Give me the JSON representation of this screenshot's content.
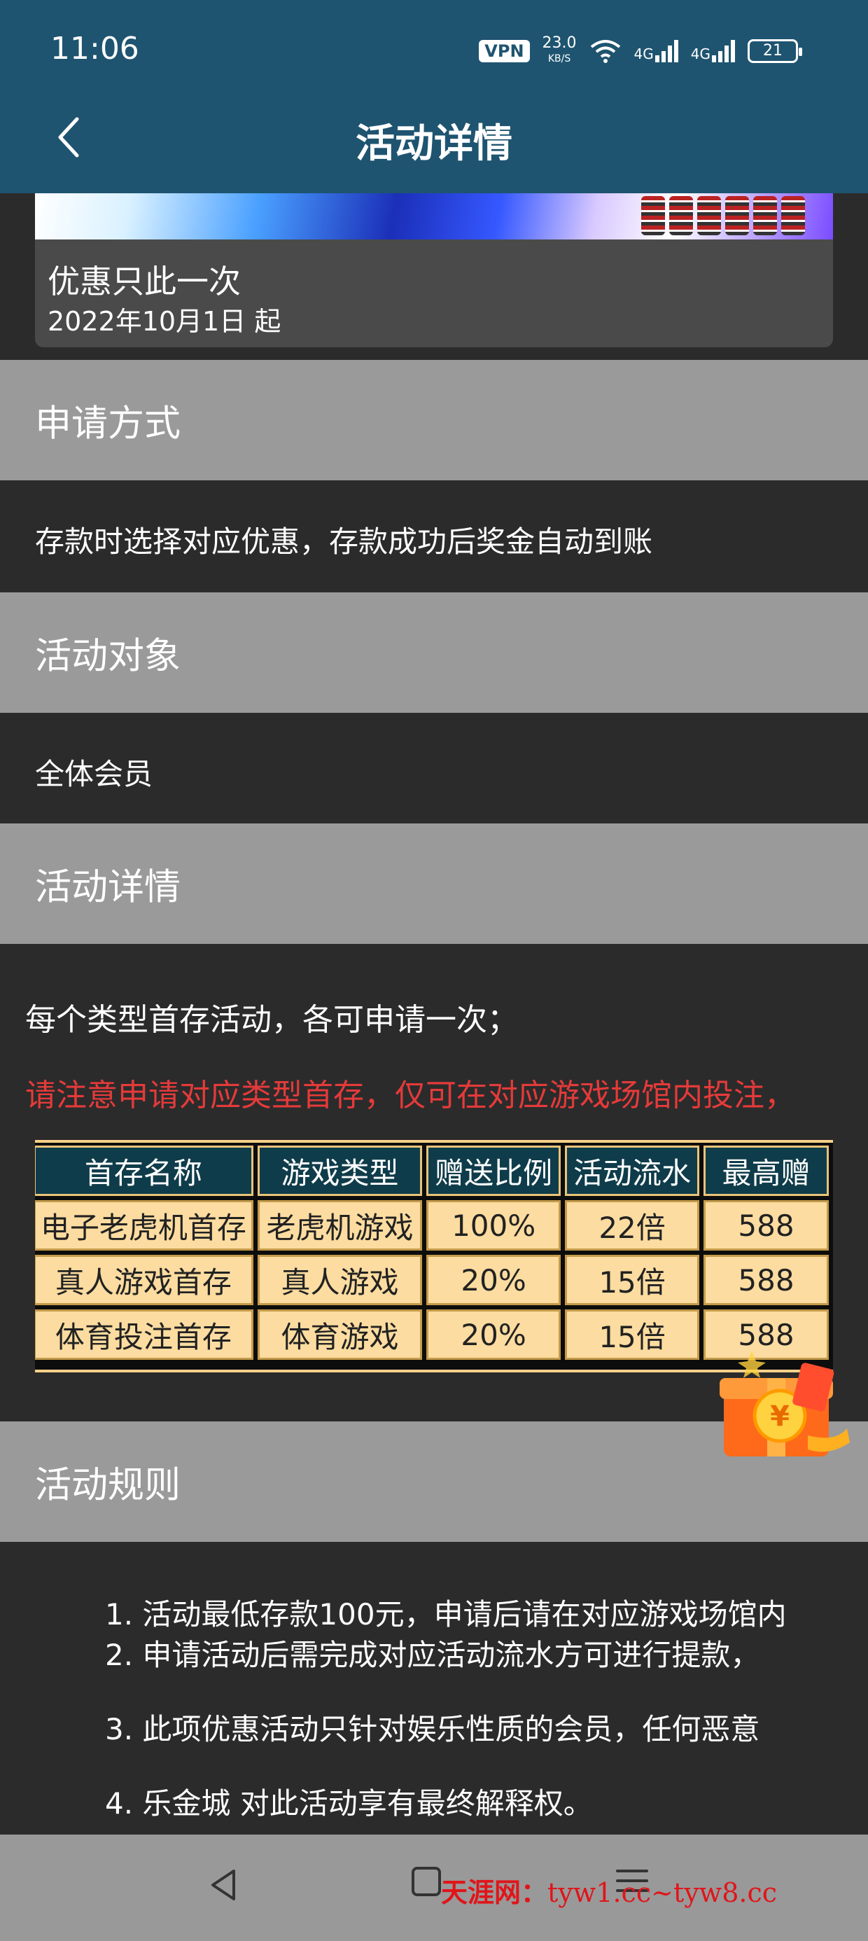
{
  "status_bar": {
    "time": "11:06",
    "vpn": "VPN",
    "net_speed": "23.0",
    "net_unit": "KB/S",
    "signal1": "4G",
    "signal2": "4G",
    "battery": "21"
  },
  "header": {
    "title": "活动详情",
    "back_icon": "chevron-left-icon"
  },
  "promo_card": {
    "title": "优惠只此一次",
    "date": "2022年10月1日 起"
  },
  "sections": {
    "apply": {
      "heading": "申请方式",
      "body": "存款时选择对应优惠，存款成功后奖金自动到账"
    },
    "target": {
      "heading": "活动对象",
      "body": "全体会员"
    },
    "details": {
      "heading": "活动详情",
      "line1": "每个类型首存活动，各可申请一次；",
      "line2": "请注意申请对应类型首存，仅可在对应游戏场馆内投注，"
    },
    "rules": {
      "heading": "活动规则",
      "items": [
        "1. 活动最低存款100元，申请后请在对应游戏场馆内",
        "2. 申请活动后需完成对应活动流水方可进行提款，",
        "3. 此项优惠活动只针对娱乐性质的会员，任何恶意",
        "4. 乐金城 对此活动享有最终解释权。"
      ]
    }
  },
  "table": {
    "headers": [
      "首存名称",
      "游戏类型",
      "赠送比例",
      "活动流水",
      "最高赠"
    ],
    "rows": [
      [
        "电子老虎机首存",
        "老虎机游戏",
        "100%",
        "22倍",
        "588"
      ],
      [
        "真人游戏首存",
        "真人游戏",
        "20%",
        "15倍",
        "588"
      ],
      [
        "体育投注首存",
        "体育游戏",
        "20%",
        "15倍",
        "588"
      ]
    ]
  },
  "colors": {
    "header_bg": "#1e5470",
    "section_head_bg": "#9a9a9a",
    "body_bg": "#2b2b2b",
    "warning_text": "#e53a3a",
    "table_head_bg": "#0f3c4a",
    "table_cell_bg": "#fcdca0"
  },
  "nav": {
    "back_icon": "triangle-back-icon",
    "home_icon": "square-home-icon",
    "menu_icon": "menu-lines-icon"
  },
  "watermark": {
    "name": "天涯网：",
    "urls": "tyw1.cc~tyw8.cc"
  }
}
